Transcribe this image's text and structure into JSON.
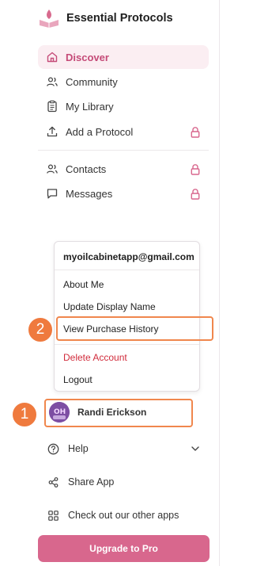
{
  "brand": {
    "title": "Essential Protocols"
  },
  "nav": {
    "primary": [
      {
        "label": "Discover",
        "icon": "home-icon",
        "active": true,
        "locked": false
      },
      {
        "label": "Community",
        "icon": "users-icon",
        "active": false,
        "locked": false
      },
      {
        "label": "My Library",
        "icon": "clipboard-icon",
        "active": false,
        "locked": false
      },
      {
        "label": "Add a Protocol",
        "icon": "upload-icon",
        "active": false,
        "locked": true
      }
    ],
    "secondary": [
      {
        "label": "Contacts",
        "icon": "users-icon",
        "locked": true
      },
      {
        "label": "Messages",
        "icon": "message-icon",
        "locked": true
      }
    ]
  },
  "user_menu": {
    "email": "myoilcabinetapp@gmail.com",
    "items": [
      "About Me",
      "Update Display Name",
      "View Purchase History"
    ],
    "danger_items": [
      "Delete Account"
    ],
    "logout": "Logout"
  },
  "user": {
    "name": "Randi Erickson"
  },
  "annotations": {
    "badge_1": "1",
    "badge_2": "2"
  },
  "bottom": {
    "help": "Help",
    "share": "Share App",
    "other_apps": "Check out our other apps",
    "upgrade": "Upgrade to Pro"
  },
  "colors": {
    "accent": "#d8678d",
    "accent_text": "#c54b78",
    "active_bg": "#fbeef2",
    "highlight": "#ef7a3e",
    "danger": "#d12c3c"
  }
}
